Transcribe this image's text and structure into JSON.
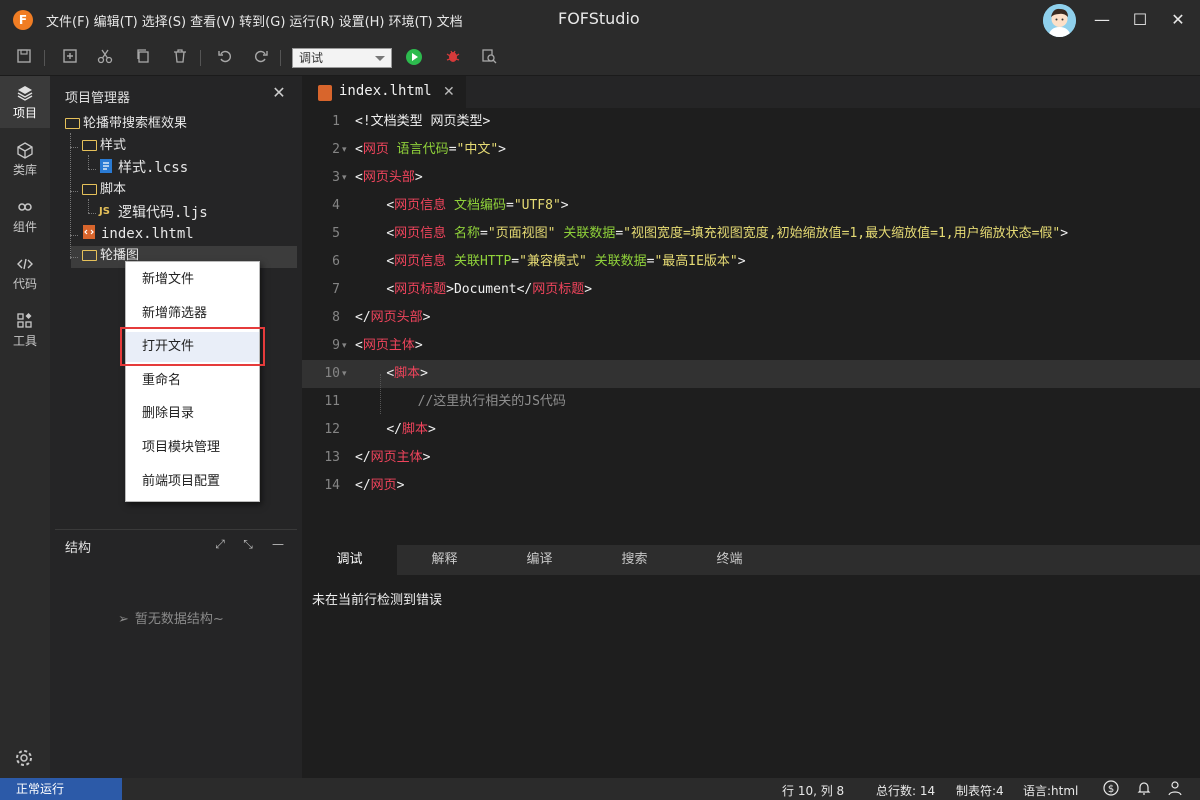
{
  "app": {
    "logo_letter": "F",
    "title": "FOFStudio",
    "menu": [
      "文件(F)",
      "编辑(T)",
      "选择(S)",
      "查看(V)",
      "转到(G)",
      "运行(R)",
      "设置(H)",
      "环境(T)",
      "文档"
    ]
  },
  "window": {
    "minimize": "—",
    "maximize": "☐",
    "close": "✕"
  },
  "toolbar": {
    "mode_select": "调试",
    "icons": [
      "save-icon",
      "new-file-icon",
      "cut-icon",
      "copy-icon",
      "delete-icon",
      "undo-icon",
      "redo-icon",
      "run-icon",
      "debug-icon",
      "search-file-icon"
    ]
  },
  "activity": {
    "items": [
      {
        "label": "项目",
        "icon": "layers-icon"
      },
      {
        "label": "类库",
        "icon": "cube-icon"
      },
      {
        "label": "组件",
        "icon": "link-icon"
      },
      {
        "label": "代码",
        "icon": "code-icon"
      },
      {
        "label": "工具",
        "icon": "tools-icon"
      }
    ]
  },
  "explorer": {
    "title": "项目管理器",
    "close": "✕",
    "tree": {
      "root": "轮播带搜索框效果",
      "style_folder": "样式",
      "style_file": "样式.lcss",
      "script_folder": "脚本",
      "script_badge": "JS",
      "script_file": "逻辑代码.ljs",
      "html_file": "index.lhtml",
      "carousel_folder": "轮播图"
    }
  },
  "context_menu": {
    "items": [
      "新增文件",
      "新增筛选器",
      "打开文件",
      "重命名",
      "删除目录",
      "项目模块管理",
      "前端项目配置"
    ],
    "highlighted": "打开文件"
  },
  "structure": {
    "title": "结构",
    "empty_text": "暂无数据结构~"
  },
  "editor": {
    "tab_name": "index.lhtml",
    "tab_close": "✕",
    "lines": {
      "l1": "<!文档类型 网页类型>",
      "l2_tag": "网页",
      "l2_attr": "语言代码",
      "l2_val": "\"中文\"",
      "l3_tag": "网页头部",
      "l4_tag": "网页信息",
      "l4_attr": "文档编码",
      "l4_val": "\"UTF8\"",
      "l5_tag": "网页信息",
      "l5_attr1": "名称",
      "l5_val1": "\"页面视图\"",
      "l5_attr2": "关联数据",
      "l5_val2": "\"视图宽度=填充视图宽度,初始缩放值=1,最大缩放值=1,用户缩放状态=假\"",
      "l6_tag": "网页信息",
      "l6_attr1": "关联HTTP",
      "l6_val1": "\"兼容模式\"",
      "l6_attr2": "关联数据",
      "l6_val2": "\"最高IE版本\"",
      "l7_tag": "网页标题",
      "l7_text": "Document",
      "l8_tag": "网页头部",
      "l9_tag": "网页主体",
      "l10_tag": "脚本",
      "l11_comment": "//这里执行相关的JS代码",
      "l12_tag": "脚本",
      "l13_tag": "网页主体",
      "l14_tag": "网页"
    },
    "current_line": 10
  },
  "bottom_panel": {
    "tabs": [
      "调试",
      "解释",
      "编译",
      "搜索",
      "终端"
    ],
    "active_tab": "调试",
    "message": "未在当前行检测到错误"
  },
  "status": {
    "run_state": "正常运行",
    "position": "行 10, 列 8",
    "total_lines": "总行数: 14",
    "tab_size": "制表符:4",
    "language": "语言:html"
  },
  "colors": {
    "tag": "#f0445c",
    "attribute": "#8fd13a",
    "string": "#e6db74",
    "status_accent": "#2c5aa8",
    "highlight_box": "#e53b3b"
  }
}
